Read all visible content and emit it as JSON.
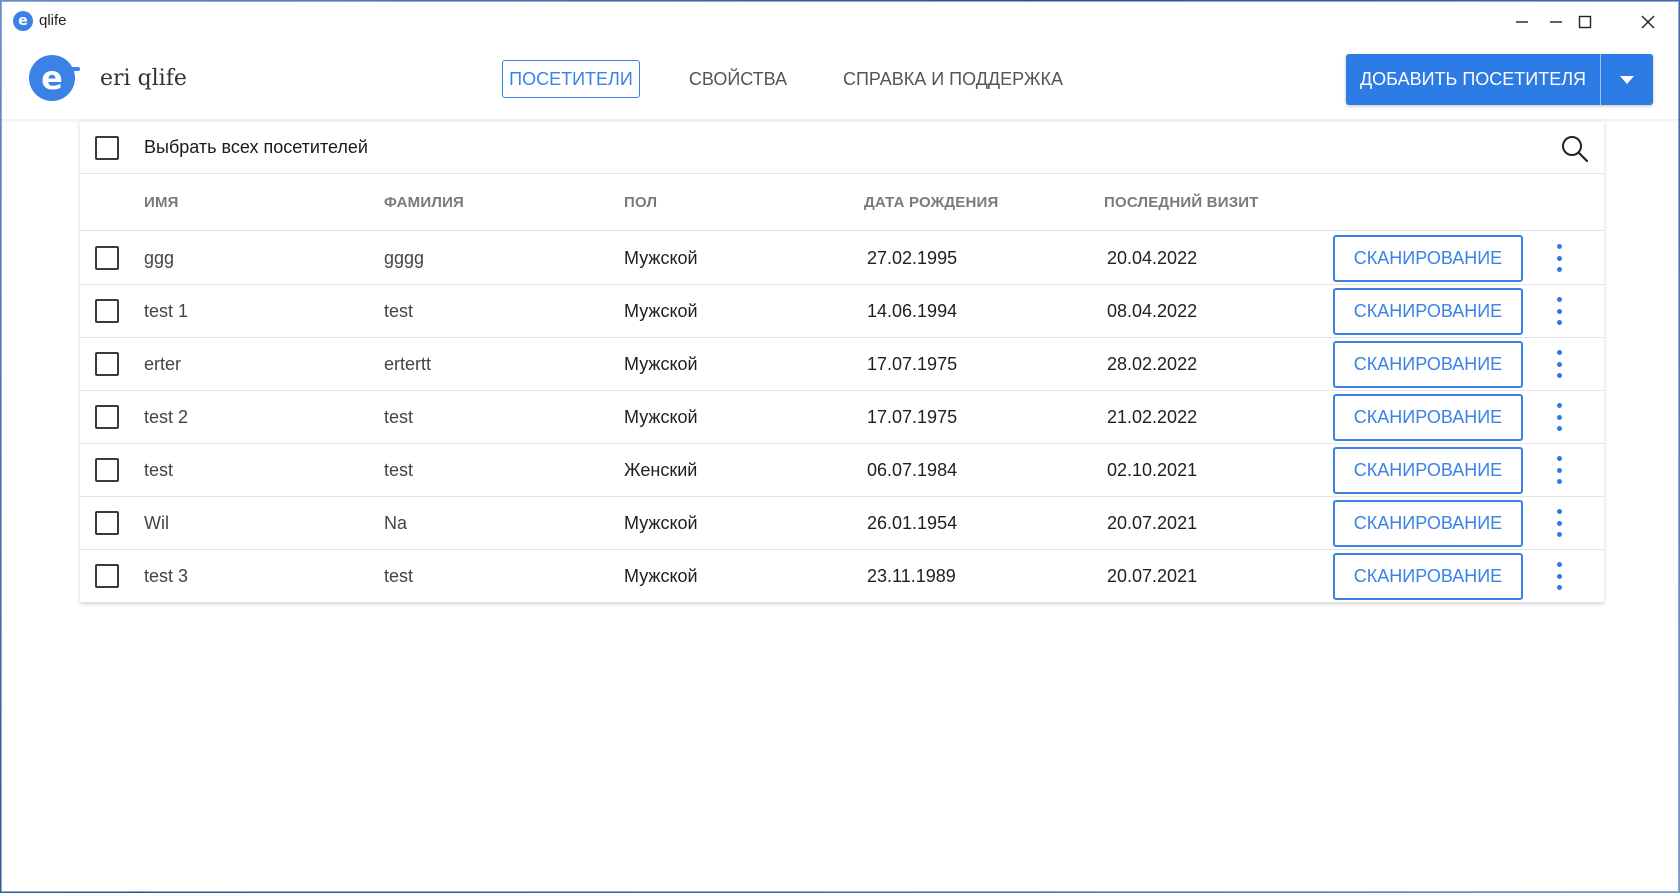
{
  "window": {
    "title": "qlife",
    "app_icon_letter": "e"
  },
  "header": {
    "logo_letter": "e",
    "brand": "eri qlife",
    "nav": [
      {
        "label": "ПОСЕТИТЕЛИ",
        "active": true
      },
      {
        "label": "СВОЙСТВА",
        "active": false
      },
      {
        "label": "СПРАВКА И ПОДДЕРЖКА",
        "active": false
      }
    ],
    "add_button_label": "ДОБАВИТЬ ПОСЕТИТЕЛЯ"
  },
  "table": {
    "select_all_label": "Выбрать всех посетителей",
    "columns": [
      "ИМЯ",
      "ФАМИЛИЯ",
      "ПОЛ",
      "ДАТА РОЖДЕНИЯ",
      "ПОСЛЕДНИЙ ВИЗИТ"
    ],
    "scan_label": "СКАНИРОВАНИЕ",
    "rows": [
      {
        "first": "ggg",
        "last": "gggg",
        "gender": "Мужской",
        "birth": "27.02.1995",
        "visit": "20.04.2022"
      },
      {
        "first": "test 1",
        "last": "test",
        "gender": "Мужской",
        "birth": "14.06.1994",
        "visit": "08.04.2022"
      },
      {
        "first": "erter",
        "last": "ertertt",
        "gender": "Мужской",
        "birth": "17.07.1975",
        "visit": "28.02.2022"
      },
      {
        "first": "test 2",
        "last": "test",
        "gender": "Мужской",
        "birth": "17.07.1975",
        "visit": "21.02.2022"
      },
      {
        "first": "test",
        "last": "test",
        "gender": "Женский",
        "birth": "06.07.1984",
        "visit": "02.10.2021"
      },
      {
        "first": "Wil",
        "last": "Na",
        "gender": "Мужской",
        "birth": "26.01.1954",
        "visit": "20.07.2021"
      },
      {
        "first": "test 3",
        "last": "test",
        "gender": "Мужской",
        "birth": "23.11.1989",
        "visit": "20.07.2021"
      }
    ]
  },
  "colors": {
    "accent": "#2d7be5",
    "accent_outline": "#3b82e6"
  }
}
